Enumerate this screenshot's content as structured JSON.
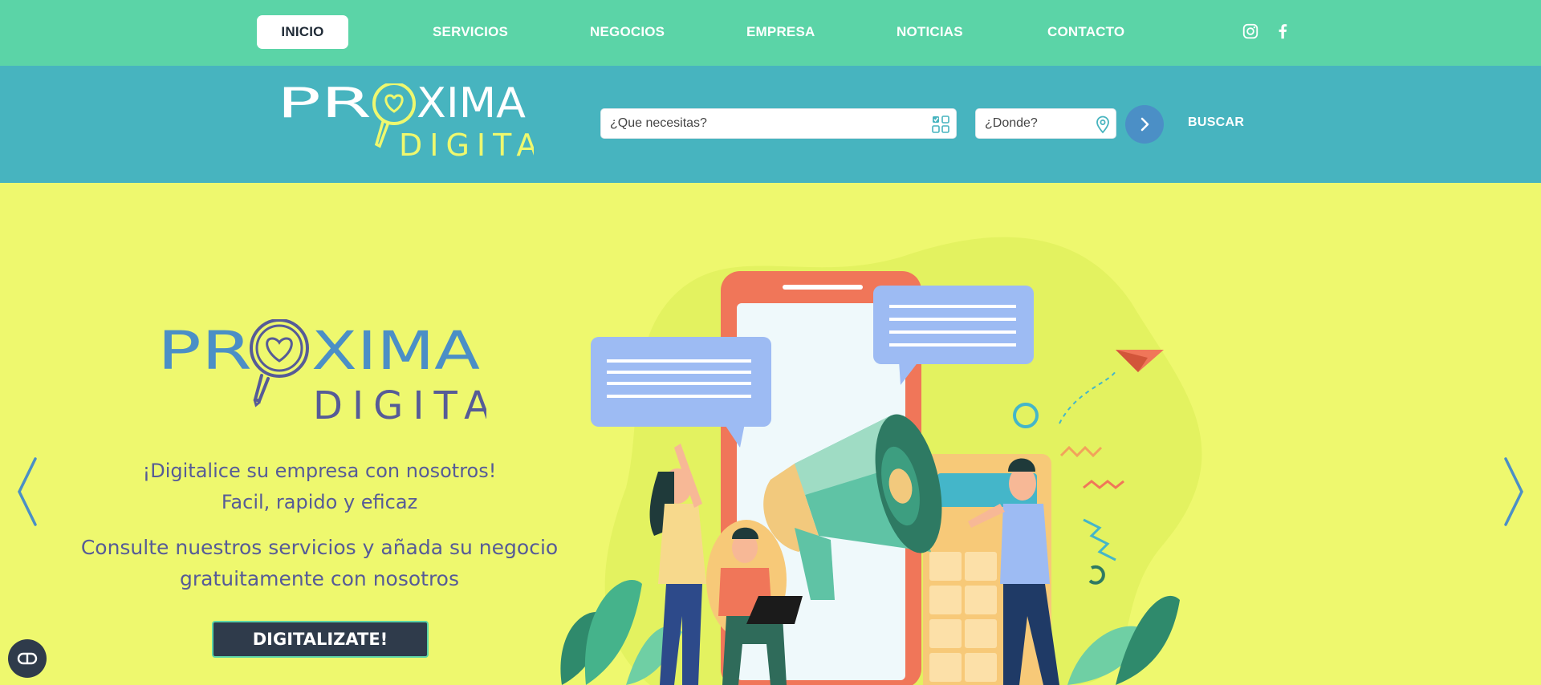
{
  "nav": {
    "items": [
      {
        "label": "INICIO",
        "active": true
      },
      {
        "label": "SERVICIOS"
      },
      {
        "label": "NEGOCIOS"
      },
      {
        "label": "EMPRESA"
      },
      {
        "label": "NOTICIAS"
      },
      {
        "label": "CONTACTO"
      }
    ],
    "social": [
      "instagram-icon",
      "facebook-icon"
    ]
  },
  "header": {
    "logo": {
      "word": "PROXIMA",
      "sub": "DIGITAL"
    },
    "search": {
      "what_placeholder": "¿Que necesitas?",
      "where_placeholder": "¿Donde?",
      "go_icon": "chevron-right-icon",
      "buscar_label": "BUSCAR"
    }
  },
  "hero": {
    "logo": {
      "word": "PROXIMA",
      "sub": "DIGITAL"
    },
    "tagline_1": "¡Digitalice su empresa con nosotros!",
    "tagline_2": "Facil, rapido y eficaz",
    "body_1": "Consulte nuestros servicios y añada su negocio",
    "body_2": "gratuitamente con nosotros",
    "cta_label": "DIGITALIZATE!",
    "prev_icon": "chevron-left-icon",
    "next_icon": "chevron-right-icon"
  },
  "colors": {
    "nav_bg": "#5bd4a7",
    "header_bg": "#47b4bf",
    "hero_bg": "#eef86e",
    "accent_blue": "#4b8fc6",
    "text_purple": "#565b97",
    "dark": "#2f3b4b"
  }
}
